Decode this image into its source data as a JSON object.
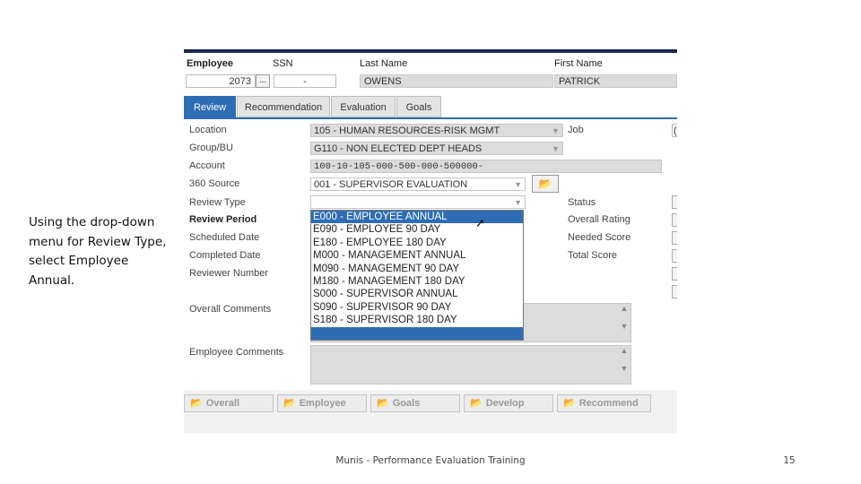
{
  "instruction": "Using the drop-down menu for Review Type, select Employee Annual.",
  "footer": {
    "title": "Munis - Performance Evaluation Training",
    "page": "15"
  },
  "header": {
    "employee_label": "Employee",
    "ssn_label": "SSN",
    "last_name_label": "Last Name",
    "first_name_label": "First Name",
    "employee_value": "2073",
    "dots": "...",
    "ssn_value": "-",
    "last_name_value": "OWENS",
    "first_name_value": "PATRICK"
  },
  "tabs": [
    {
      "label": "Review",
      "active": true
    },
    {
      "label": "Recommendation",
      "active": false
    },
    {
      "label": "Evaluation",
      "active": false
    },
    {
      "label": "Goals",
      "active": false
    }
  ],
  "form": {
    "location_label": "Location",
    "location_value": "105 - HUMAN RESOURCES-RISK MGMT",
    "group_label": "Group/BU",
    "group_value": "G110 - NON ELECTED DEPT HEADS",
    "account_label": "Account",
    "account_value": "100-10-105-000-500-000-500000-",
    "source_label": "360 Source",
    "source_value": "001 - SUPERVISOR EVALUATION",
    "review_type_label": "Review Type",
    "review_period_label": "Review Period",
    "scheduled_date_label": "Scheduled Date",
    "completed_date_label": "Completed Date",
    "reviewer_number_label": "Reviewer Number",
    "overall_comments_label": "Overall Comments",
    "employee_comments_label": "Employee Comments",
    "job_label": "Job",
    "job_value": "(",
    "status_label": "Status",
    "overall_rating_label": "Overall Rating",
    "needed_score_label": "Needed Score",
    "total_score_label": "Total Score"
  },
  "dropdown": {
    "options": [
      "E000 - EMPLOYEE ANNUAL",
      "E090 - EMPLOYEE 90 DAY",
      "E180 - EMPLOYEE 180 DAY",
      "M000 - MANAGEMENT ANNUAL",
      "M090 - MANAGEMENT 90 DAY",
      "M180 - MANAGEMENT 180 DAY",
      "S000 - SUPERVISOR ANNUAL",
      "S090 - SUPERVISOR 90 DAY",
      "S180 - SUPERVISOR 180 DAY"
    ],
    "highlighted": "E000 - EMPLOYEE ANNUAL"
  },
  "bottom_buttons": [
    "Overall",
    "Employee",
    "Goals",
    "Develop",
    "Recommend"
  ],
  "colors": {
    "accent": "#2e6db4",
    "topbar": "#1b2a4a",
    "field_bg": "#dcdcdc"
  }
}
